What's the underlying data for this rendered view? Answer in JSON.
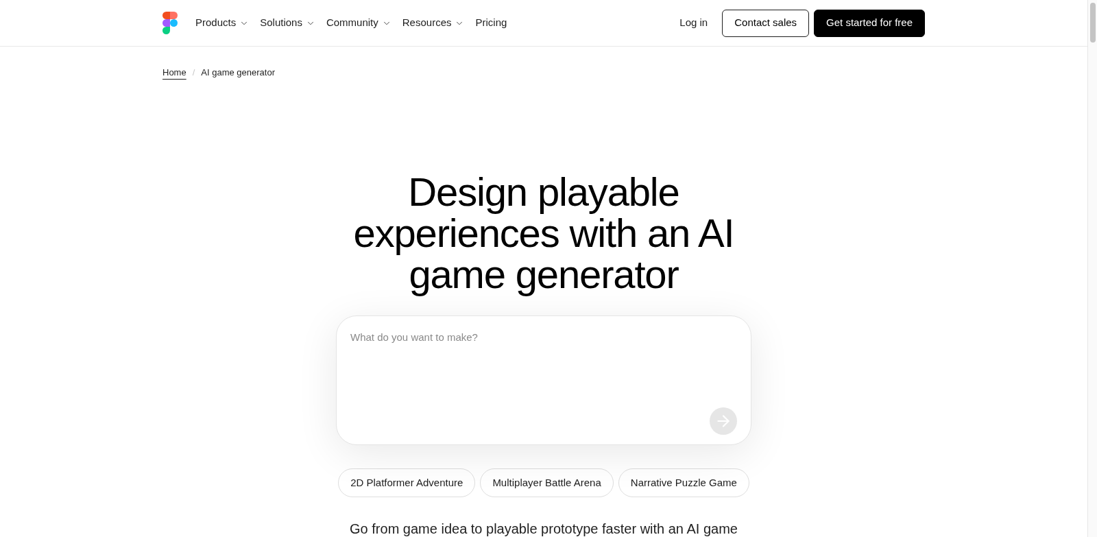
{
  "nav": {
    "items": [
      {
        "label": "Products",
        "has_menu": true
      },
      {
        "label": "Solutions",
        "has_menu": true
      },
      {
        "label": "Community",
        "has_menu": true
      },
      {
        "label": "Resources",
        "has_menu": true
      },
      {
        "label": "Pricing",
        "has_menu": false
      }
    ],
    "actions": [
      {
        "label": "Log in",
        "kind": "link"
      },
      {
        "label": "Contact sales",
        "kind": "outline"
      },
      {
        "label": "Get started for free",
        "kind": "solid"
      }
    ]
  },
  "breadcrumb": {
    "separator": "/",
    "items": [
      {
        "label": "Home",
        "current": false
      },
      {
        "label": "AI game generator",
        "current": true
      }
    ]
  },
  "hero": {
    "headline_lines": [
      "Design playable",
      "experiences with an AI",
      "game generator"
    ],
    "prompt": {
      "placeholder": "What do you want to make?",
      "send_button": {
        "disabled": true
      }
    },
    "suggestions": [
      "2D Platformer Adventure",
      "Multiplayer Battle Arena",
      "Narrative Puzzle Game"
    ],
    "description": "Go from game idea to playable prototype faster with an AI game"
  }
}
